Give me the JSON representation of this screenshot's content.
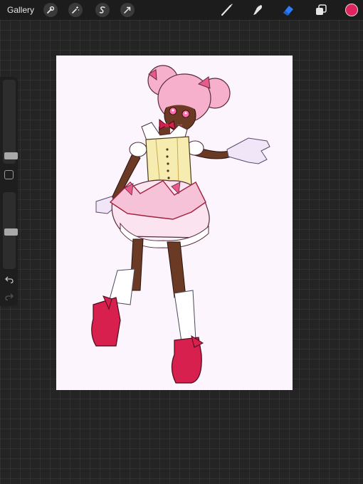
{
  "topbar": {
    "gallery_label": "Gallery",
    "left_tools": [
      {
        "name": "actions",
        "icon": "wrench-icon"
      },
      {
        "name": "adjustments",
        "icon": "magic-wand-icon"
      },
      {
        "name": "selection",
        "icon": "selection-s-icon"
      },
      {
        "name": "transform",
        "icon": "arrow-cursor-icon"
      }
    ],
    "right_tools": [
      {
        "name": "brush",
        "icon": "brush-icon"
      },
      {
        "name": "smudge",
        "icon": "smudge-finger-icon"
      },
      {
        "name": "eraser",
        "icon": "eraser-icon",
        "active": true
      },
      {
        "name": "layers",
        "icon": "layers-icon"
      }
    ],
    "current_color": "#e0245e",
    "active_tool_color": "#2f7cf6"
  },
  "sidebar": {
    "brush_size_level": 0.06,
    "opacity_level": 0.5
  },
  "canvas": {
    "background": "#fcf5fd"
  }
}
